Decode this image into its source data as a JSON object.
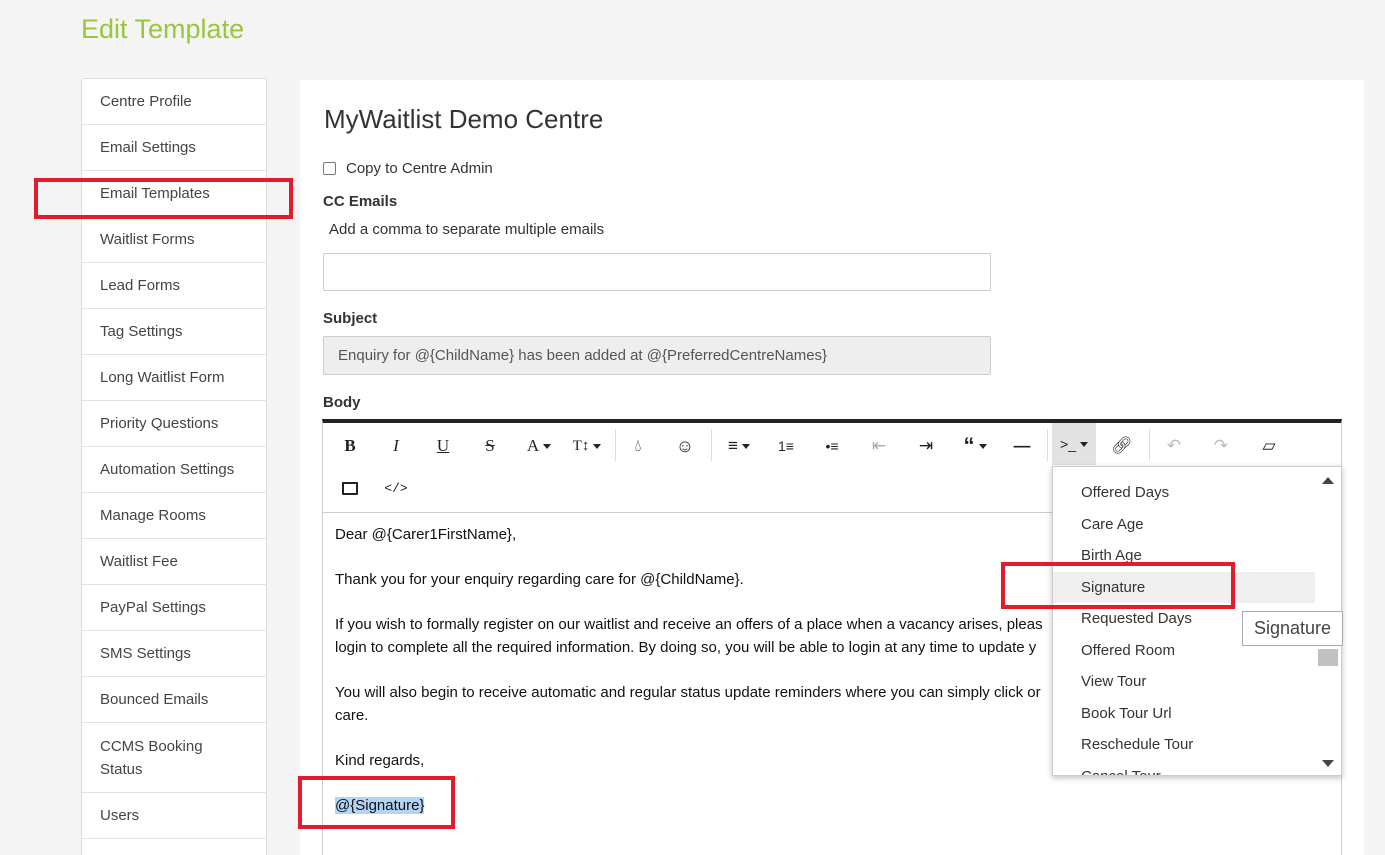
{
  "page_title": "Edit Template",
  "sidebar": {
    "items": [
      {
        "label": "Centre Profile"
      },
      {
        "label": "Email Settings"
      },
      {
        "label": "Email Templates"
      },
      {
        "label": "Waitlist Forms"
      },
      {
        "label": "Lead Forms"
      },
      {
        "label": "Tag Settings"
      },
      {
        "label": "Long Waitlist Form"
      },
      {
        "label": "Priority Questions"
      },
      {
        "label": "Automation Settings"
      },
      {
        "label": "Manage Rooms"
      },
      {
        "label": "Waitlist Fee"
      },
      {
        "label": "PayPal Settings"
      },
      {
        "label": "SMS Settings"
      },
      {
        "label": "Bounced Emails"
      },
      {
        "label": "CCMS Booking Status"
      },
      {
        "label": "Users"
      }
    ]
  },
  "form": {
    "centre_name": "MyWaitlist Demo Centre",
    "copy_label": "Copy to Centre Admin",
    "cc_label": "CC Emails",
    "cc_hint": "Add a comma to separate multiple emails",
    "cc_value": "",
    "subject_label": "Subject",
    "subject_value": "Enquiry for @{ChildName} has been added at @{PreferredCentreNames}",
    "body_label": "Body"
  },
  "editor": {
    "paragraphs": [
      "Dear @{Carer1FirstName},",
      "Thank you for your enquiry regarding care for @{ChildName}.",
      "If you wish to formally register on our waitlist and receive an offers of a place when a vacancy arises, pleas",
      "login to complete all the required information. By doing so, you will be able to login at any time to update y",
      "You will also begin to receive automatic and regular status update reminders where you can simply click or",
      "care.",
      "Kind regards,"
    ],
    "selected_token": "@{Signature}"
  },
  "dropdown": {
    "items": [
      "Offered Days",
      "Care Age",
      "Birth Age",
      "Signature",
      "Requested Days",
      "Offered Room",
      "View Tour",
      "Book Tour Url",
      "Reschedule Tour",
      "Cancel Tour"
    ],
    "hover_index": 3,
    "tooltip": "Signature"
  },
  "colors": {
    "title_green": "#9bc53d",
    "highlight_red": "#e21c2a",
    "selection_blue": "#b3d4f5"
  }
}
